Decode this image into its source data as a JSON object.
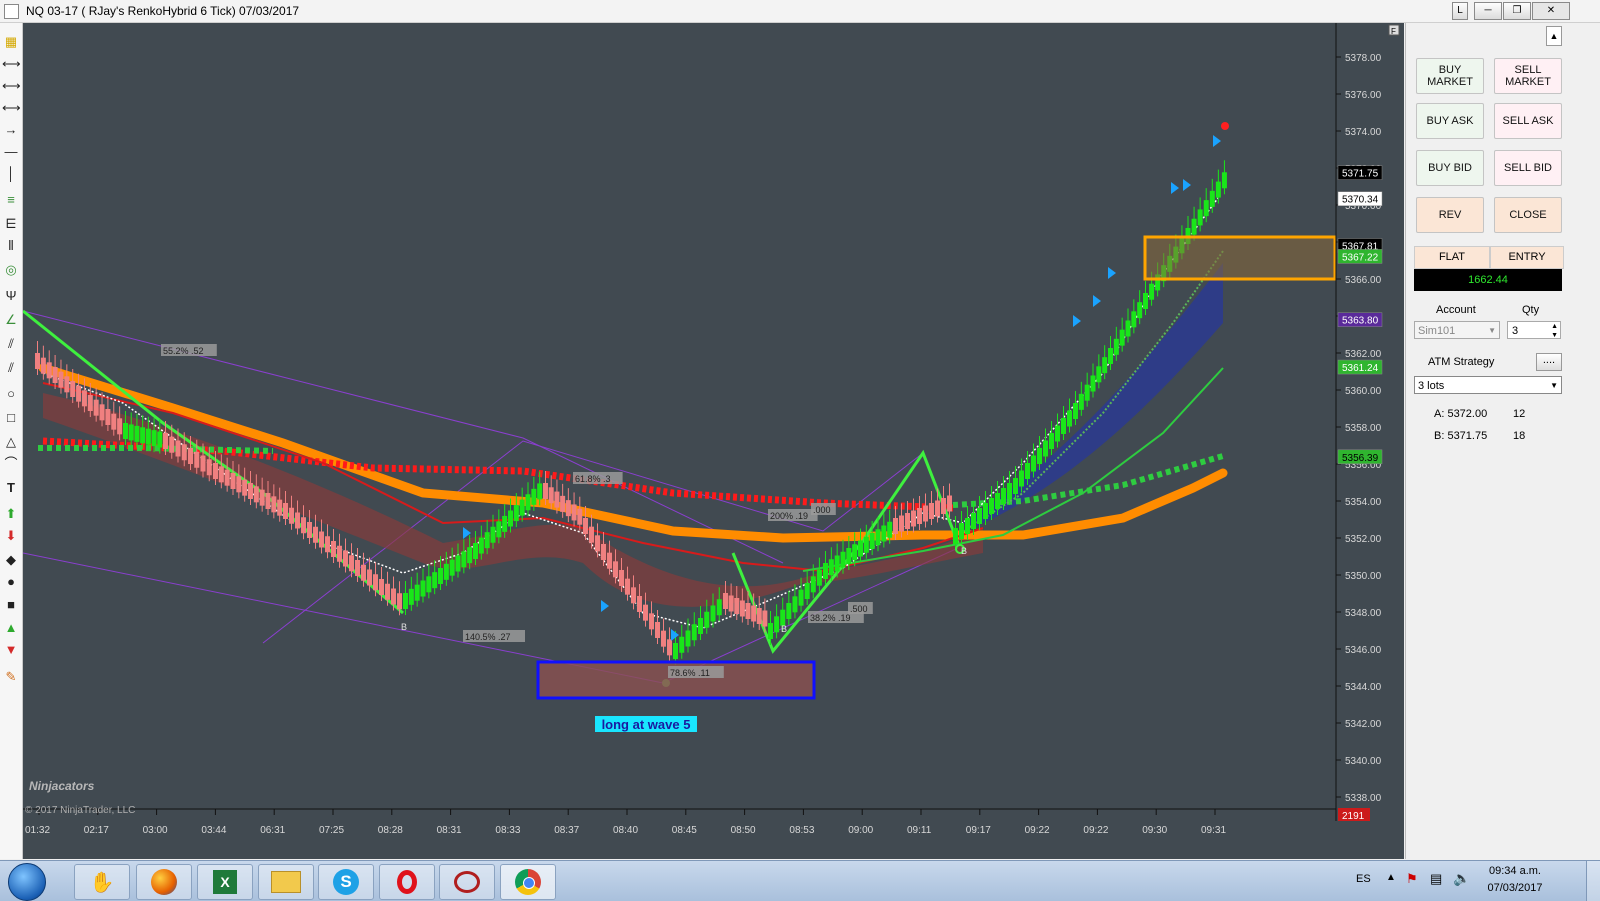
{
  "window": {
    "title": "NQ 03-17 ( RJay's RenkoHybrid  6 Tick)  07/03/2017",
    "buttons": [
      "L",
      "─",
      "❐",
      "✕"
    ]
  },
  "chart": {
    "price_ticks": [
      "5378.00",
      "5376.00",
      "5374.00",
      "5372.00",
      "5370.00",
      "5368.00",
      "5366.00",
      "5364.00",
      "5362.00",
      "5360.00",
      "5358.00",
      "5356.00",
      "5354.00",
      "5352.00",
      "5350.00",
      "5348.00",
      "5346.00",
      "5344.00",
      "5342.00",
      "5340.00",
      "5338.00"
    ],
    "time_ticks": [
      "01:32",
      "02:17",
      "03:00",
      "03:44",
      "06:31",
      "07:25",
      "08:28",
      "08:31",
      "08:33",
      "08:37",
      "08:40",
      "08:45",
      "08:50",
      "08:53",
      "09:00",
      "09:11",
      "09:17",
      "09:22",
      "09:22",
      "09:30",
      "09:31"
    ],
    "price_badges": [
      {
        "text": "5371.75",
        "bg": "#000000",
        "fg": "#ffffff"
      },
      {
        "text": "5370.34",
        "bg": "#ffffff",
        "fg": "#000000"
      },
      {
        "text": "5367.81",
        "bg": "#000000",
        "fg": "#ffffff"
      },
      {
        "text": "5367.22",
        "bg": "#2fb52f",
        "fg": "#ffffff"
      },
      {
        "text": "5363.80",
        "bg": "#5a2a9a",
        "fg": "#ffffff"
      },
      {
        "text": "5361.24",
        "bg": "#2fb52f",
        "fg": "#ffffff"
      },
      {
        "text": "5356.39",
        "bg": "#2fb52f",
        "fg": "#000000"
      }
    ],
    "bar_counter": "2191",
    "annotation": "long at wave 5",
    "fib_labels": [
      "55.2% .52",
      "140.5% .27",
      "78.6% .11",
      "61.8% .3",
      "200% .19",
      "38.2% .19",
      ".000",
      ".500"
    ],
    "wave_labels": [
      "B",
      "B",
      "B"
    ],
    "copyright": "© 2017 NinjaTrader, LLC",
    "brand": "Ninjacators",
    "panel_marker": "F",
    "colors": {
      "bg": "#414a51",
      "up": "#19e619",
      "down": "#f08080",
      "red_line": "#ff1a1a",
      "orange_band": "#ff8c00",
      "green_dots": "#2ecc40",
      "blue_fill": "#2b3990"
    }
  },
  "order_panel": {
    "buy_market": "BUY MARKET",
    "sell_market": "SELL MARKET",
    "buy_ask": "BUY ASK",
    "sell_ask": "SELL ASK",
    "buy_bid": "BUY BID",
    "sell_bid": "SELL BID",
    "rev": "REV",
    "close": "CLOSE",
    "flat": "FLAT",
    "entry": "ENTRY",
    "pnl": "1662.44",
    "account_label": "Account",
    "qty_label": "Qty",
    "account_value": "Sim101",
    "qty_value": "3",
    "atm_label": "ATM Strategy",
    "atm_btn": "....",
    "atm_value": "3 lots",
    "ask_label": "A: 5372.00",
    "ask_size": "12",
    "bid_label": "B: 5371.75",
    "bid_size": "18"
  },
  "taskbar": {
    "lang": "ES",
    "time": "09:34 a.m.",
    "date": "07/03/2017",
    "apps": [
      "start-orb",
      "hand-app",
      "firefox",
      "excel",
      "explorer",
      "skype",
      "opera",
      "ninjatrader",
      "chrome"
    ]
  }
}
